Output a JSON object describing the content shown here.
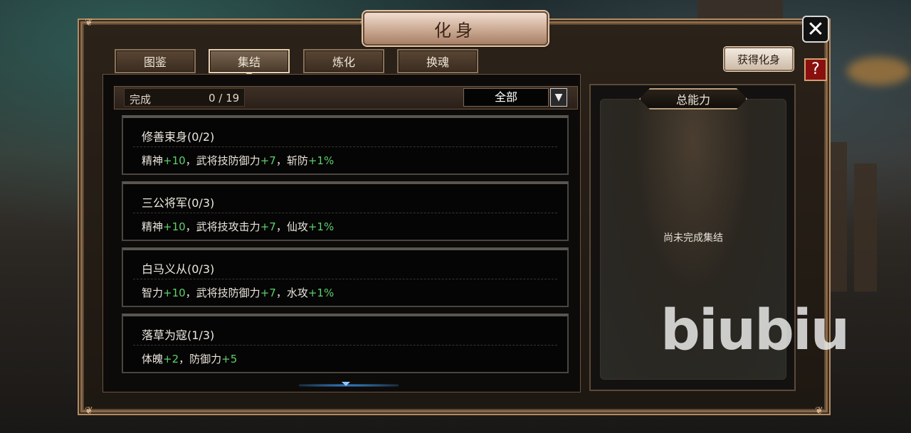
{
  "window": {
    "title": "化身",
    "close_icon": "close-icon",
    "help_label": "?"
  },
  "tabs": [
    {
      "label": "图鉴",
      "active": false
    },
    {
      "label": "集结",
      "active": true
    },
    {
      "label": "炼化",
      "active": false
    },
    {
      "label": "换魂",
      "active": false
    }
  ],
  "obtain_button": "获得化身",
  "list": {
    "done_label": "完成",
    "done_count": "0 / 19",
    "filter_value": "全部",
    "filter_icon": "dropdown-arrow-icon",
    "items": [
      {
        "title": "修善束身(0/2)",
        "desc": [
          {
            "text": "精神",
            "g": false
          },
          {
            "text": "+10",
            "g": true
          },
          {
            "text": "，武将技防御力",
            "g": false
          },
          {
            "text": "+7",
            "g": true
          },
          {
            "text": "，斩防",
            "g": false
          },
          {
            "text": "+1%",
            "g": true
          }
        ]
      },
      {
        "title": "三公将军(0/3)",
        "desc": [
          {
            "text": "精神",
            "g": false
          },
          {
            "text": "+10",
            "g": true
          },
          {
            "text": "，武将技攻击力",
            "g": false
          },
          {
            "text": "+7",
            "g": true
          },
          {
            "text": "，仙攻",
            "g": false
          },
          {
            "text": "+1%",
            "g": true
          }
        ]
      },
      {
        "title": "白马义从(0/3)",
        "desc": [
          {
            "text": "智力",
            "g": false
          },
          {
            "text": "+10",
            "g": true
          },
          {
            "text": "，武将技防御力",
            "g": false
          },
          {
            "text": "+7",
            "g": true
          },
          {
            "text": "，水攻",
            "g": false
          },
          {
            "text": "+1%",
            "g": true
          }
        ]
      },
      {
        "title": "落草为寇(1/3)",
        "desc": [
          {
            "text": "体魄",
            "g": false
          },
          {
            "text": "+2",
            "g": true
          },
          {
            "text": "，防御力",
            "g": false
          },
          {
            "text": "+5",
            "g": true
          }
        ]
      }
    ]
  },
  "ability_panel": {
    "title": "总能力",
    "empty_message": "尚未完成集结"
  },
  "watermark": "biubiu",
  "colors": {
    "bonus_green": "#5ed06a",
    "help_red": "#8a1010"
  }
}
